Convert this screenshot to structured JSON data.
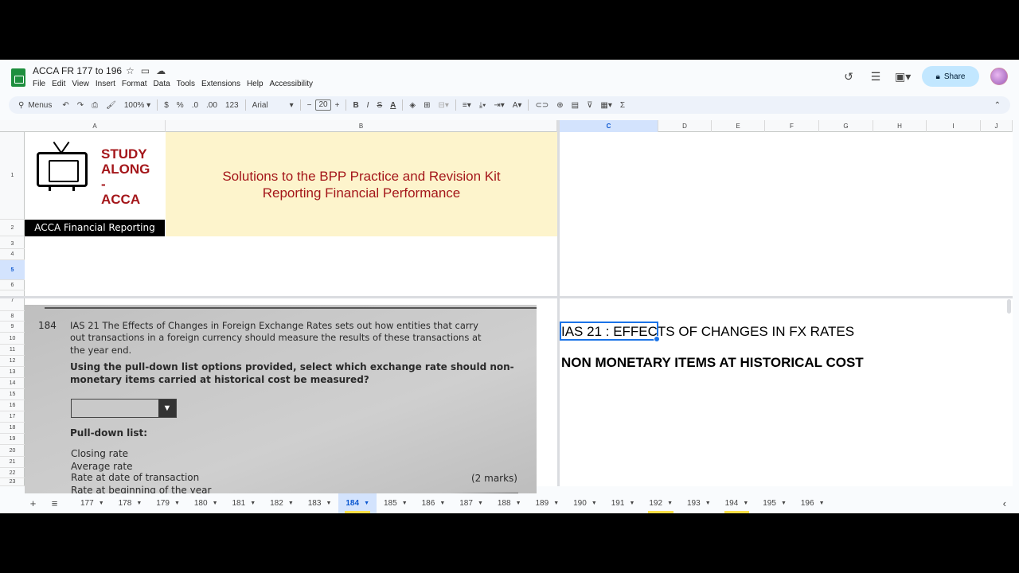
{
  "doc": {
    "title": "ACCA FR 177 to 196"
  },
  "menu": [
    "File",
    "Edit",
    "View",
    "Insert",
    "Format",
    "Data",
    "Tools",
    "Extensions",
    "Help",
    "Accessibility"
  ],
  "share_label": "Share",
  "toolbar": {
    "menus_label": "Menus",
    "zoom": "100%",
    "currency": "$",
    "percent": "%",
    "dec_decrease": ".0",
    "dec_increase": ".00",
    "number_format": "123",
    "font": "Arial",
    "font_size": "20",
    "bold": "B",
    "italic": "I",
    "strike": "S",
    "text_color": "A",
    "text_rotation": "A"
  },
  "columns": [
    "A",
    "B",
    "C",
    "D",
    "E",
    "F",
    "G",
    "H",
    "I",
    "J"
  ],
  "rows": [
    "1",
    "2",
    "3",
    "4",
    "5",
    "6",
    "7",
    "8",
    "9",
    "10",
    "11",
    "12",
    "13",
    "14",
    "15",
    "16",
    "17",
    "18",
    "19",
    "20",
    "21",
    "22",
    "23"
  ],
  "banner": {
    "study_lines": [
      "STUDY",
      "ALONG",
      "-",
      "ACCA"
    ],
    "acca_label": "ACCA Financial Reporting",
    "title_line1": "Solutions to the BPP Practice and Revision Kit",
    "title_line2": "Reporting Financial Performance"
  },
  "question": {
    "number": "184",
    "line1": "IAS 21 The Effects of Changes in Foreign Exchange Rates sets out how entities that carry",
    "line2": "out transactions in a foreign currency should measure the results of these transactions at",
    "line3": "the year end.",
    "prompt1": "Using the pull-down list options provided, select which exchange rate should non-",
    "prompt2": "monetary items carried at historical cost be measured?",
    "pulldown_title": "Pull-down list:",
    "options": [
      "Closing rate",
      "Average rate",
      "Rate at date of transaction",
      "Rate at beginning of the year"
    ],
    "marks": "(2 marks)"
  },
  "cells": {
    "c5": "IAS 21 : EFFECTS OF CHANGES IN FX RATES",
    "c7": "NON MONETARY ITEMS AT HISTORICAL COST"
  },
  "sheet_tabs": [
    "177",
    "178",
    "179",
    "180",
    "181",
    "182",
    "183",
    "184",
    "185",
    "186",
    "187",
    "188",
    "189",
    "190",
    "191",
    "192",
    "193",
    "194",
    "195",
    "196"
  ],
  "active_tab": "184",
  "highlighted_tabs": [
    "184",
    "192",
    "194"
  ],
  "colors": {
    "accent": "#0b57d0",
    "banner_red": "#a4161a",
    "banner_bg": "#fdf4cc",
    "share_bg": "#c2e7ff"
  }
}
